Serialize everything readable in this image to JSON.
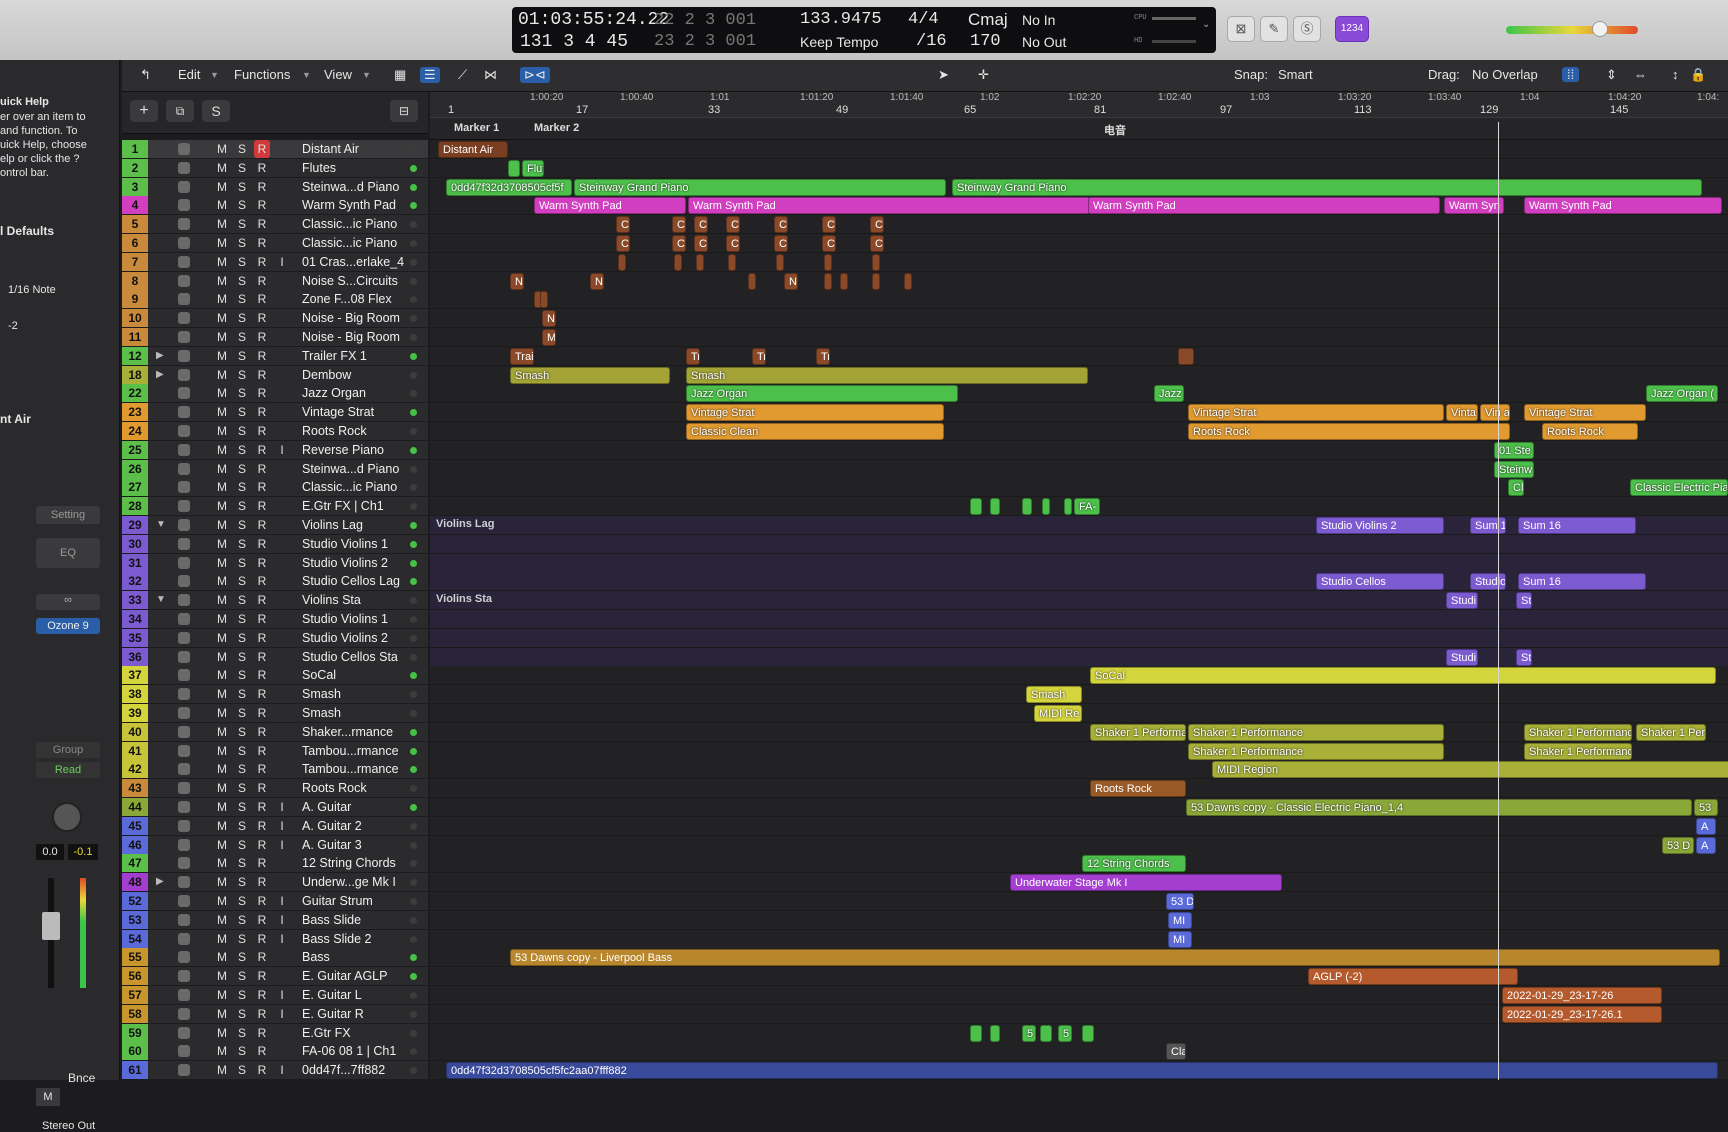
{
  "transport": {
    "time": "01:03:55:24.22",
    "bars": "131  3  4   45",
    "beats_top": "22  2  3   001",
    "beats_bot": "23  2  3   001",
    "tempo": "133.9475",
    "tempo_mode": "Keep Tempo",
    "sig": "4/4",
    "div": "/16",
    "key": "Cmaj",
    "key_val": "170",
    "in": "No In",
    "out": "No Out",
    "cpu": "CPU",
    "hd": "HD",
    "badge": "1234"
  },
  "toolbar": {
    "edit": "Edit",
    "functions": "Functions",
    "view": "View",
    "snap_label": "Snap:",
    "snap": "Smart",
    "drag_label": "Drag:",
    "drag": "No Overlap"
  },
  "left": {
    "quick_help": "uick Help",
    "qh1": "er over an item to",
    "qh2": "and function. To",
    "qh3": "uick Help, choose",
    "qh4": "elp or click the ?",
    "qh5": "ontrol bar.",
    "defaults": "l Defaults",
    "note": "1/16 Note",
    "val": "-2",
    "track": "nt Air",
    "setting": "Setting",
    "eq": "EQ",
    "plugin": "Ozone 9",
    "group": "Group",
    "read": "Read",
    "v1": "0.0",
    "v2": "-0.1",
    "bnce": "Bnce",
    "m": "M",
    "out": "Stereo Out"
  },
  "header": {
    "s": "S"
  },
  "ruler": [
    [
      "1:00:20",
      530
    ],
    [
      "1:00:40",
      620
    ],
    [
      "1:01",
      710
    ],
    [
      "1:01:20",
      800
    ],
    [
      "1:01:40",
      890
    ],
    [
      "1:02",
      980
    ],
    [
      "1:02:20",
      1068
    ],
    [
      "1:02:40",
      1158
    ],
    [
      "1:03",
      1250
    ],
    [
      "1:03:20",
      1338
    ],
    [
      "1:03:40",
      1428
    ],
    [
      "1:04",
      1520
    ],
    [
      "1:04:20",
      1608
    ],
    [
      "1:04:",
      1697
    ]
  ],
  "bars": [
    [
      "1",
      448
    ],
    [
      "17",
      576
    ],
    [
      "33",
      708
    ],
    [
      "49",
      836
    ],
    [
      "65",
      964
    ],
    [
      "81",
      1094
    ],
    [
      "97",
      1220
    ],
    [
      "113",
      1354
    ],
    [
      "129",
      1480
    ],
    [
      "145",
      1610
    ]
  ],
  "markers": [
    [
      "Marker 1",
      454
    ],
    [
      "Marker 2",
      534
    ],
    [
      "电音",
      1104
    ]
  ],
  "tracks": [
    [
      "1",
      "Distant Air",
      "#5cbf4a",
      "#8a4a2a"
    ],
    [
      "2",
      "Flutes",
      "#5cbf4a",
      ""
    ],
    [
      "3",
      "Steinwa...d Piano",
      "#5cbf4a",
      ""
    ],
    [
      "4",
      "Warm Synth Pad",
      "#d23ec0",
      ""
    ],
    [
      "5",
      "Classic...ic Piano",
      "#c98a3c",
      ""
    ],
    [
      "6",
      "Classic...ic Piano",
      "#c98a3c",
      ""
    ],
    [
      "7",
      "01 Cras...erlake_4",
      "#c98a3c",
      ""
    ],
    [
      "8",
      "Noise S...Circuits",
      "#c98a3c",
      ""
    ],
    [
      "9",
      "Zone F...08 Flex",
      "#c98a3c",
      ""
    ],
    [
      "10",
      "Noise - Big Room",
      "#c98a3c",
      ""
    ],
    [
      "11",
      "Noise - Big Room",
      "#c98a3c",
      ""
    ],
    [
      "12",
      "Trailer FX 1",
      "#5cbf4a",
      ""
    ],
    [
      "18",
      "Dembow",
      "#a8b038",
      ""
    ],
    [
      "22",
      "Jazz Organ",
      "#5cbf4a",
      ""
    ],
    [
      "23",
      "Vintage Strat",
      "#e09a30",
      ""
    ],
    [
      "24",
      "Roots Rock",
      "#e09a30",
      ""
    ],
    [
      "25",
      "Reverse Piano",
      "#5cbf4a",
      ""
    ],
    [
      "26",
      "Steinwa...d Piano",
      "#5cbf4a",
      ""
    ],
    [
      "27",
      "Classic...ic Piano",
      "#5cbf4a",
      ""
    ],
    [
      "28",
      "E.Gtr FX | Ch1",
      "#5cbf4a",
      ""
    ],
    [
      "29",
      "Violins Lag",
      "#7c5ad0",
      ""
    ],
    [
      "30",
      "Studio Violins 1",
      "#7c5ad0",
      ""
    ],
    [
      "31",
      "Studio Violins 2",
      "#7c5ad0",
      ""
    ],
    [
      "32",
      "Studio Cellos Lag",
      "#7c5ad0",
      ""
    ],
    [
      "33",
      "Violins Sta",
      "#7c5ad0",
      ""
    ],
    [
      "34",
      "Studio Violins 1",
      "#7c5ad0",
      ""
    ],
    [
      "35",
      "Studio Violins 2",
      "#7c5ad0",
      ""
    ],
    [
      "36",
      "Studio Cellos Sta",
      "#7c5ad0",
      ""
    ],
    [
      "37",
      "SoCal",
      "#d4d43c",
      ""
    ],
    [
      "38",
      "Smash",
      "#d4d43c",
      ""
    ],
    [
      "39",
      "Smash",
      "#d4d43c",
      ""
    ],
    [
      "40",
      "Shaker...rmance",
      "#c8c43a",
      ""
    ],
    [
      "41",
      "Tambou...rmance",
      "#c8c43a",
      ""
    ],
    [
      "42",
      "Tambou...rmance",
      "#c8c43a",
      ""
    ],
    [
      "43",
      "Roots Rock",
      "#c98a3c",
      ""
    ],
    [
      "44",
      "A. Guitar",
      "#8aa838",
      ""
    ],
    [
      "45",
      "A. Guitar 2",
      "#5a6ad8",
      ""
    ],
    [
      "46",
      "A. Guitar 3",
      "#5a6ad8",
      ""
    ],
    [
      "47",
      "12 String Chords",
      "#5cbf4a",
      ""
    ],
    [
      "48",
      "Underw...ge Mk I",
      "#a33ed0",
      ""
    ],
    [
      "52",
      "Guitar Strum",
      "#5a6ad8",
      ""
    ],
    [
      "53",
      "Bass Slide",
      "#5a6ad8",
      ""
    ],
    [
      "54",
      "Bass Slide 2",
      "#5a6ad8",
      ""
    ],
    [
      "55",
      "Bass",
      "#c8962c",
      ""
    ],
    [
      "56",
      "E. Guitar AGLP",
      "#c8962c",
      ""
    ],
    [
      "57",
      "E. Guitar L",
      "#c8962c",
      ""
    ],
    [
      "58",
      "E. Guitar R",
      "#c8962c",
      ""
    ],
    [
      "59",
      "E.Gtr FX",
      "#5cbf4a",
      ""
    ],
    [
      "60",
      "FA-06 08 1 | Ch1",
      "#5cbf4a",
      ""
    ],
    [
      "61",
      "0dd47f...7ff882",
      "#5a6ad8",
      ""
    ]
  ],
  "regions": [
    [
      0,
      8,
      70,
      "Distant Air",
      "#7a3e22"
    ],
    [
      1,
      78,
      12,
      "",
      "#4cc04a"
    ],
    [
      1,
      92,
      22,
      "Flut",
      "#4cc04a"
    ],
    [
      2,
      16,
      126,
      "0dd47f32d3708505cf5f",
      "#4cc04a"
    ],
    [
      2,
      144,
      372,
      "Steinway Grand Piano",
      "#4cc04a"
    ],
    [
      2,
      522,
      750,
      "Steinway Grand Piano",
      "#4cc04a"
    ],
    [
      3,
      104,
      152,
      "Warm Synth Pad",
      "#d23ec0"
    ],
    [
      3,
      258,
      402,
      "Warm Synth Pad",
      "#d23ec0"
    ],
    [
      3,
      658,
      352,
      "Warm Synth Pad",
      "#d23ec0"
    ],
    [
      3,
      1014,
      60,
      "Warm Syn",
      "#d23ec0"
    ],
    [
      3,
      1094,
      198,
      "Warm Synth Pad",
      "#d23ec0"
    ],
    [
      4,
      186,
      14,
      "Cl",
      "#8a4a2a"
    ],
    [
      4,
      242,
      14,
      "Cl",
      "#8a4a2a"
    ],
    [
      4,
      264,
      14,
      "Cl",
      "#8a4a2a"
    ],
    [
      4,
      296,
      14,
      "Cl",
      "#8a4a2a"
    ],
    [
      4,
      344,
      14,
      "Cl",
      "#8a4a2a"
    ],
    [
      4,
      392,
      14,
      "Cl",
      "#8a4a2a"
    ],
    [
      4,
      440,
      14,
      "Cl",
      "#8a4a2a"
    ],
    [
      5,
      186,
      14,
      "Cl",
      "#8a4a2a"
    ],
    [
      5,
      242,
      14,
      "Cl",
      "#8a4a2a"
    ],
    [
      5,
      264,
      14,
      "Cl",
      "#8a4a2a"
    ],
    [
      5,
      296,
      14,
      "Cl",
      "#8a4a2a"
    ],
    [
      5,
      344,
      14,
      "Cl",
      "#8a4a2a"
    ],
    [
      5,
      392,
      14,
      "Cl",
      "#8a4a2a"
    ],
    [
      5,
      440,
      14,
      "Cl",
      "#8a4a2a"
    ],
    [
      6,
      188,
      8,
      "",
      "#8a4a2a"
    ],
    [
      6,
      244,
      8,
      "",
      "#8a4a2a"
    ],
    [
      6,
      266,
      8,
      "",
      "#8a4a2a"
    ],
    [
      6,
      298,
      8,
      "",
      "#8a4a2a"
    ],
    [
      6,
      346,
      8,
      "",
      "#8a4a2a"
    ],
    [
      6,
      394,
      8,
      "",
      "#8a4a2a"
    ],
    [
      6,
      442,
      8,
      "",
      "#8a4a2a"
    ],
    [
      7,
      80,
      14,
      "N",
      "#8a4a2a"
    ],
    [
      7,
      160,
      14,
      "N",
      "#8a4a2a"
    ],
    [
      7,
      318,
      8,
      "",
      "#8a4a2a"
    ],
    [
      7,
      354,
      14,
      "N",
      "#8a4a2a"
    ],
    [
      7,
      394,
      8,
      "",
      "#8a4a2a"
    ],
    [
      7,
      410,
      8,
      "",
      "#8a4a2a"
    ],
    [
      7,
      442,
      8,
      "",
      "#8a4a2a"
    ],
    [
      7,
      474,
      8,
      "",
      "#8a4a2a"
    ],
    [
      8,
      104,
      8,
      "",
      "#8a4a2a"
    ],
    [
      8,
      110,
      8,
      "",
      "#8a4a2a"
    ],
    [
      9,
      112,
      14,
      "N",
      "#8a4a2a"
    ],
    [
      10,
      112,
      14,
      "M",
      "#8a4a2a"
    ],
    [
      11,
      80,
      24,
      "Trai",
      "#8a4a2a"
    ],
    [
      11,
      256,
      14,
      "Tr",
      "#8a4a2a"
    ],
    [
      11,
      322,
      14,
      "Tr",
      "#8a4a2a"
    ],
    [
      11,
      386,
      14,
      "Tr",
      "#8a4a2a"
    ],
    [
      11,
      748,
      16,
      "",
      "#8a4a2a"
    ],
    [
      12,
      80,
      160,
      "Smash",
      "#a4a436"
    ],
    [
      12,
      256,
      402,
      "Smash",
      "#a4a436"
    ],
    [
      13,
      256,
      272,
      "Jazz Organ",
      "#4cc04a"
    ],
    [
      13,
      724,
      30,
      "Jazz",
      "#4cc04a"
    ],
    [
      13,
      1216,
      72,
      "Jazz Organ (",
      "#4cc04a"
    ],
    [
      14,
      256,
      258,
      "Vintage Strat",
      "#e09a30"
    ],
    [
      14,
      758,
      256,
      "Vintage Strat",
      "#e09a30"
    ],
    [
      14,
      1016,
      32,
      "Vinta",
      "#e09a30"
    ],
    [
      14,
      1050,
      30,
      "Vin a",
      "#e09a30"
    ],
    [
      14,
      1094,
      122,
      "Vintage Strat",
      "#e09a30"
    ],
    [
      15,
      256,
      258,
      "Classic Clean",
      "#e09a30"
    ],
    [
      15,
      758,
      322,
      "Roots Rock",
      "#e09a30"
    ],
    [
      15,
      1112,
      96,
      "Roots Rock",
      "#e09a30"
    ],
    [
      16,
      1064,
      40,
      "01 Ste",
      "#4cc04a"
    ],
    [
      17,
      1064,
      40,
      "Steinw",
      "#4cc04a"
    ],
    [
      18,
      1078,
      16,
      "Cl",
      "#4cc04a"
    ],
    [
      18,
      1200,
      98,
      "Classic Electric Pia",
      "#4cc04a"
    ],
    [
      19,
      540,
      12,
      "",
      "#4cc04a"
    ],
    [
      19,
      560,
      10,
      "",
      "#4cc04a"
    ],
    [
      19,
      592,
      10,
      "",
      "#4cc04a"
    ],
    [
      19,
      612,
      8,
      "",
      "#4cc04a"
    ],
    [
      19,
      634,
      8,
      "",
      "#4cc04a"
    ],
    [
      19,
      644,
      26,
      "FA-",
      "#4cc04a"
    ],
    [
      20,
      886,
      128,
      "Studio Violins 2",
      "#7c5ad0"
    ],
    [
      20,
      1040,
      36,
      "Sum 1",
      "#7c5ad0"
    ],
    [
      20,
      1088,
      118,
      "Sum 16",
      "#7c5ad0"
    ],
    [
      23,
      886,
      128,
      "Studio Cellos",
      "#7c5ad0"
    ],
    [
      23,
      1040,
      36,
      "Studio",
      "#7c5ad0"
    ],
    [
      23,
      1088,
      128,
      "Sum 16",
      "#7c5ad0"
    ],
    [
      24,
      1016,
      32,
      "Studi",
      "#7c5ad0"
    ],
    [
      24,
      1086,
      16,
      "St",
      "#7c5ad0"
    ],
    [
      27,
      1016,
      32,
      "Studi",
      "#7c5ad0"
    ],
    [
      27,
      1086,
      16,
      "St",
      "#7c5ad0"
    ],
    [
      28,
      660,
      626,
      "SoCal",
      "#d4d43c"
    ],
    [
      29,
      596,
      56,
      "Smash",
      "#d4d43c"
    ],
    [
      30,
      604,
      48,
      "MIDI Re",
      "#d4d43c"
    ],
    [
      31,
      660,
      96,
      "Shaker 1 Performa",
      "#a8b038"
    ],
    [
      31,
      758,
      256,
      "Shaker 1 Performance",
      "#a8b038"
    ],
    [
      31,
      1094,
      108,
      "Shaker 1 Performanc",
      "#a8b038"
    ],
    [
      31,
      1206,
      70,
      "Shaker 1 Per",
      "#a8b038"
    ],
    [
      32,
      758,
      256,
      "Shaker 1 Performance",
      "#a8b038"
    ],
    [
      32,
      1094,
      108,
      "Shaker 1 Performanc",
      "#a8b038"
    ],
    [
      33,
      782,
      518,
      "MIDI Region",
      "#a8b038"
    ],
    [
      34,
      660,
      96,
      "Roots Rock",
      "#9a5a28"
    ],
    [
      35,
      756,
      506,
      "53 Dawns copy - Classic Electric Piano_1,4",
      "#8aa838"
    ],
    [
      35,
      1264,
      24,
      "53",
      "#8aa838"
    ],
    [
      36,
      1266,
      20,
      "A",
      "#5a6ad8"
    ],
    [
      37,
      1232,
      32,
      "53 D",
      "#8aa838"
    ],
    [
      37,
      1266,
      20,
      "A",
      "#5a6ad8"
    ],
    [
      38,
      652,
      104,
      "12 String Chords",
      "#4cc04a"
    ],
    [
      39,
      580,
      272,
      "Underwater Stage Mk I",
      "#a33ed0"
    ],
    [
      40,
      736,
      28,
      "53 D",
      "#5a6ad8"
    ],
    [
      41,
      738,
      24,
      "MI",
      "#5a6ad8"
    ],
    [
      42,
      738,
      24,
      "MI",
      "#5a6ad8"
    ],
    [
      43,
      80,
      1210,
      "53 Dawns copy - Liverpool Bass",
      "#b8862c"
    ],
    [
      44,
      878,
      210,
      "AGLP (-2)",
      "#b45a2c"
    ],
    [
      45,
      1072,
      160,
      "2022-01-29_23-17-26",
      "#b45a2c"
    ],
    [
      46,
      1072,
      160,
      "2022-01-29_23-17-26.1",
      "#b45a2c"
    ],
    [
      47,
      540,
      12,
      "",
      "#4cc04a"
    ],
    [
      47,
      560,
      10,
      "",
      "#4cc04a"
    ],
    [
      47,
      592,
      14,
      "5",
      "#4cc04a"
    ],
    [
      47,
      610,
      12,
      "",
      "#4cc04a"
    ],
    [
      47,
      628,
      14,
      "5",
      "#4cc04a"
    ],
    [
      47,
      652,
      12,
      "",
      "#4cc04a"
    ],
    [
      48,
      736,
      20,
      "Cla",
      "#555"
    ],
    [
      49,
      16,
      1272,
      "0dd47f32d3708505cf5fc2aa07fff882",
      "#3a4a9a"
    ]
  ],
  "violins_lag": "Violins Lag",
  "violins_sta": "Violins Sta"
}
